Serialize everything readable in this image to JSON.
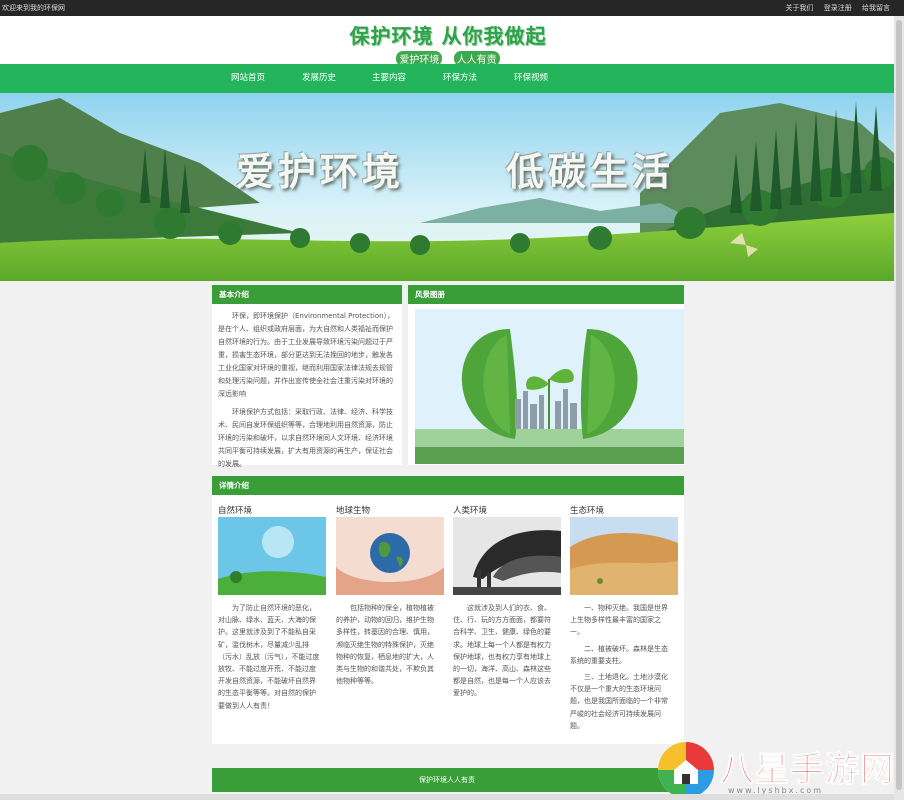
{
  "topbar": {
    "welcome": "欢迎来到我的环保网",
    "links": [
      "关于我们",
      "登录注册",
      "给我留言"
    ]
  },
  "header": {
    "logo_line1": "保护环境 从你我做起",
    "logo_line2": [
      "爱护环境",
      "人人有责"
    ]
  },
  "nav": {
    "items": [
      "网站首页",
      "发展历史",
      "主要内容",
      "环保方法",
      "环保视频"
    ]
  },
  "banner": {
    "left_text": "爱护环境",
    "right_text": "低碳生活"
  },
  "intro": {
    "title": "基本介绍",
    "paragraphs": [
      "环保，即环境保护（Environmental Protection），是在个人、组织或政府层面，为大自然和人类福祉而保护自然环境的行为。由于工业发展导致环境污染问题过于严重，损害生态环境，部分更达到无法挽回的地步，触发各工业化国家对环境的重视，继而利用国家法律法规去规管和处理污染问题，并作出宣传使全社会注重污染对环境的深远影响",
      "环境保护方式包括：采取行政、法律、经济、科学技术、民间自发环保组织等等，合理地利用自然资源，防止环境的污染和破坏，以求自然环境同人文环境、经济环境共同平衡可持续发展，扩大有用资源的再生产，保证社会的发展。"
    ]
  },
  "gallery": {
    "title": "风景图册"
  },
  "details": {
    "title": "详情介绍",
    "columns": [
      {
        "title": "自然环境",
        "paragraphs": [
          "为了防止自然环境的恶化，对山脉、绿水、蓝天、大海的保护。这里就涉及到了不能私自采矿，滥伐树木，尽量减少乱排（污水）乱放（污气），不能过度放牧、不能过度开荒、不能过度开发自然资源，不能破坏自然界的生态平衡等等。对自然的保护要做到人人有责！"
        ]
      },
      {
        "title": "地球生物",
        "paragraphs": [
          "包括物种的保全，植物植被的养护，动物的回归，维护生物多样性，转基因的合理、慎用，濒临灭绝生物的特殊保护，灭绝物种的恢复，栖息地的扩大，人类与生物的和谐共处，不欺负其他物种等等。"
        ]
      },
      {
        "title": "人类环境",
        "paragraphs": [
          "这就涉及到人们的衣、食、住、行、玩的方方面面，都要符合科学、卫生、健康、绿色的要求。地球上每一个人都是有权力保护地球，也有权力享有地球上的一切，海洋、高山、森林这些都是自然，也是每一个人应该去爱护的。"
        ]
      },
      {
        "title": "生态环境",
        "paragraphs": [
          "一、物种灭绝。我国是世界上生物多样性最丰富的国家之一。",
          "二、植被破坏。森林是生态系统的重要支柱。",
          "三、土地退化。土地沙漠化不仅是一个重大的生态环境问题，也是我国所面临的一个非常严峻的社会经济可持续发展问题。"
        ]
      }
    ]
  },
  "footer": {
    "text": "保护环境人人有责"
  },
  "watermark": {
    "text": "八星手游网",
    "url": "www.lyshbx.com"
  },
  "colors": {
    "nav_green": "#24b55c",
    "panel_green": "#3a9e38",
    "topbar": "#262626"
  }
}
